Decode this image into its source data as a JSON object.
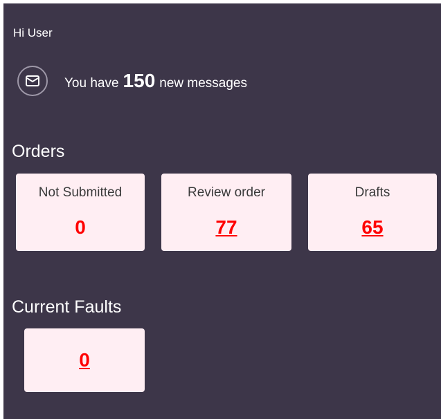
{
  "greeting": "Hi User",
  "messages": {
    "prefix": "You have",
    "count": "150",
    "suffix": "new messages",
    "icon": "envelope-icon"
  },
  "orders": {
    "title": "Orders",
    "cards": [
      {
        "label": "Not Submitted",
        "value": "0"
      },
      {
        "label": "Review order",
        "value": "77"
      },
      {
        "label": "Drafts",
        "value": "65"
      }
    ]
  },
  "faults": {
    "title": "Current Faults",
    "value": "0"
  },
  "colors": {
    "panel_bg": "#3d3649",
    "card_bg": "#ffeef3",
    "value_red": "#ff0000"
  }
}
